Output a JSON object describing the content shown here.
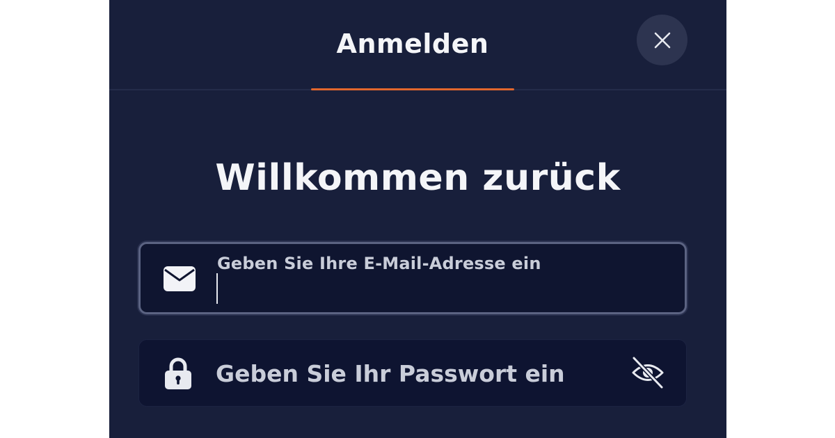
{
  "header": {
    "tab_label": "Anmelden",
    "accent_color": "#e2672d"
  },
  "close_button": {
    "icon": "close-icon"
  },
  "welcome": {
    "title": "Willkommen zurück"
  },
  "email_field": {
    "icon": "envelope-icon",
    "label": "Geben Sie Ihre E-Mail-Adresse ein",
    "value": ""
  },
  "password_field": {
    "icon": "lock-icon",
    "placeholder": "Geben Sie Ihr Passwort ein",
    "value": "",
    "toggle_icon": "eye-slash-icon"
  },
  "colors": {
    "background": "#181f3b",
    "field_background": "#0f1530",
    "text": "#f4f5f8"
  }
}
